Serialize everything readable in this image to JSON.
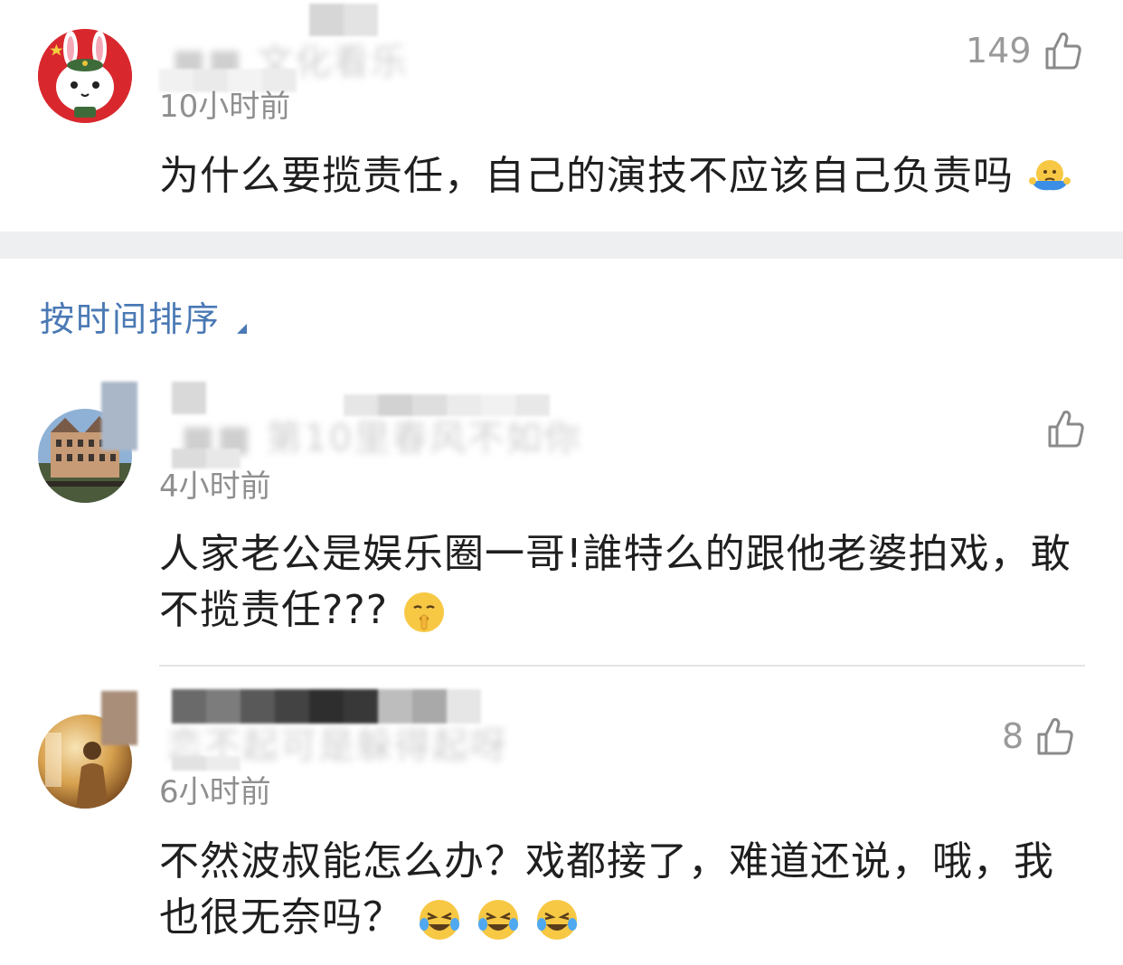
{
  "top_comment": {
    "likes": "149",
    "time": "10小时前",
    "text": "为什么要揽责任，自己的演技不应该自己负责吗",
    "emoji": "shrug-emoji"
  },
  "sort": {
    "label": "按时间排序"
  },
  "comments": [
    {
      "likes": "",
      "time": "4小时前",
      "text": "人家老公是娱乐圈一哥!誰特么的跟他老婆拍戏，敢不揽责任???",
      "emoji": "shush-emoji"
    },
    {
      "likes": "8",
      "time": "6小时前",
      "text": "不然波叔能怎么办？戏都接了，难道还说，哦，我也很无奈吗？",
      "emoji": "laugh-cry-emoji x3"
    }
  ],
  "colors": {
    "link_blue": "#4a79b4",
    "divider": "#eeeff1",
    "muted": "#8f8f8f"
  }
}
